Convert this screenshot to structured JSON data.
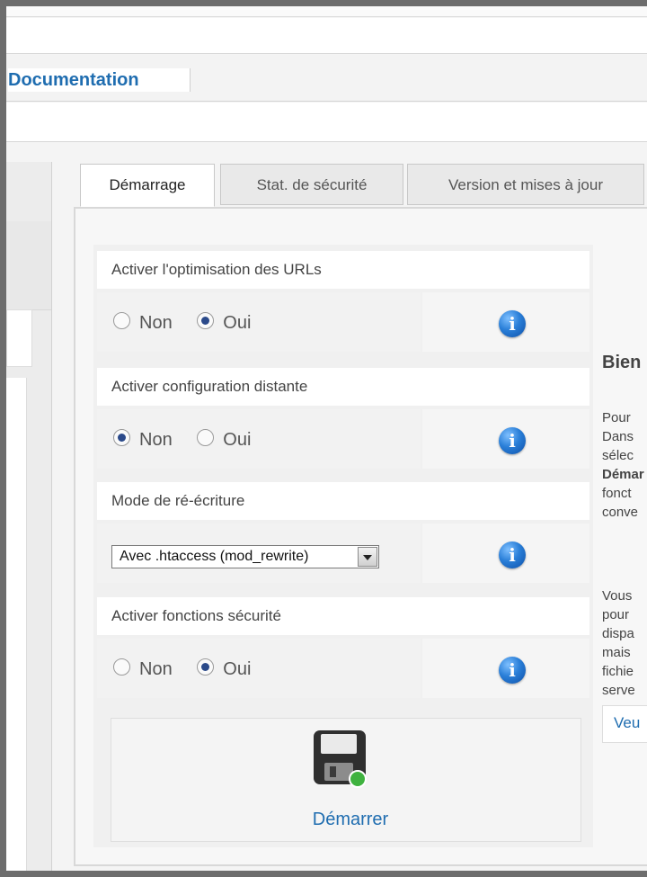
{
  "nav": {
    "documentation": "Documentation"
  },
  "tabs": [
    {
      "label": "Démarrage",
      "active": true
    },
    {
      "label": "Stat. de sécurité",
      "active": false
    },
    {
      "label": "Version et mises à jour",
      "active": false
    }
  ],
  "options": [
    {
      "title": "Activer l'optimisation des URLs",
      "type": "radio",
      "choices": [
        "Non",
        "Oui"
      ],
      "selected": "Oui"
    },
    {
      "title": "Activer configuration distante",
      "type": "radio",
      "choices": [
        "Non",
        "Oui"
      ],
      "selected": "Non"
    },
    {
      "title": "Mode de ré-écriture",
      "type": "select",
      "value": "Avec .htaccess (mod_rewrite)"
    },
    {
      "title": "Activer fonctions sécurité",
      "type": "radio",
      "choices": [
        "Non",
        "Oui"
      ],
      "selected": "Oui"
    }
  ],
  "info_icon_glyph": "i",
  "save": {
    "label": "Démarrer",
    "icon": "floppy-disk-icon"
  },
  "right": {
    "title": "Bien",
    "lines": [
      "Pour",
      "Dans",
      "sélec",
      "Démar",
      "fonct",
      "conve",
      "",
      "Vous",
      "pour",
      "dispa",
      "mais",
      "fichie",
      "serve"
    ],
    "link": "Veu"
  },
  "colors": {
    "link": "#1f6db0",
    "frame": "#6d6d6d"
  }
}
